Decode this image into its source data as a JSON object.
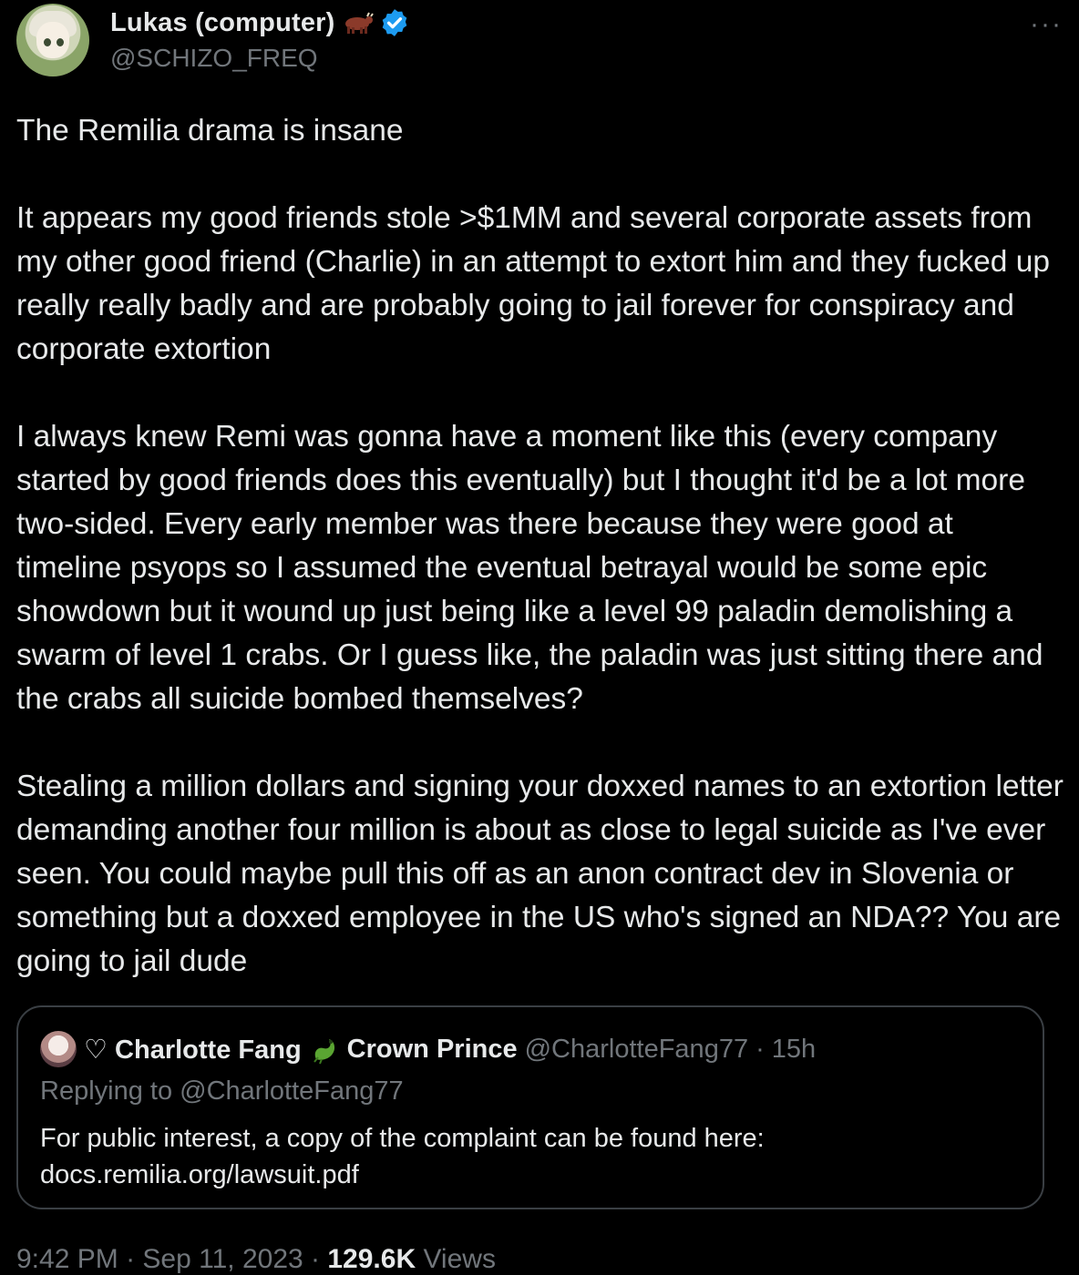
{
  "author": {
    "display_name": "Lukas (computer)",
    "handle": "@SCHIZO_FREQ",
    "name_emoji": "bull-emoji",
    "verified": true
  },
  "tweet": {
    "paragraphs": [
      "The Remilia drama is insane",
      "It appears my good friends stole >$1MM and several corporate assets from my other good friend (Charlie) in an attempt to extort him and they fucked up really really badly and are probably going to jail forever for conspiracy and corporate extortion",
      "I always knew Remi was gonna have a moment like this (every company started by good friends does this eventually) but I thought it'd be a lot more two-sided. Every early member was there because they were good at timeline psyops so I assumed the eventual betrayal would be some epic showdown but it wound up just being like a level 99 paladin demolishing a swarm of level 1 crabs. Or I guess like, the paladin was just sitting there and the crabs all suicide bombed themselves?",
      "Stealing a million dollars and signing your doxxed names to an extortion letter demanding another four million is about as close to legal suicide as I've ever seen. You could maybe pull this off as an anon contract dev in Slovenia or something but a doxxed employee in the US who's signed an NDA?? You are going to jail dude"
    ]
  },
  "quoted_tweet": {
    "name_part1": "♡ Charlotte Fang",
    "name_emoji": "dragon-emoji",
    "name_part2": "Crown Prince",
    "handle": "@CharlotteFang77",
    "separator": "·",
    "time": "15h",
    "replying_to": "Replying to @CharlotteFang77",
    "text_line1": "For public interest, a copy of the complaint can be found here:",
    "text_line2": "docs.remilia.org/lawsuit.pdf"
  },
  "footer": {
    "time": "9:42 PM",
    "date": "Sep 11, 2023",
    "separator": "·",
    "views_count": "129.6K",
    "views_label": "Views"
  },
  "colors": {
    "background": "#000000",
    "text": "#e7e9ea",
    "muted": "#71767b",
    "verified": "#1d9bf0",
    "border": "#3a3f44"
  },
  "more_label": "···"
}
